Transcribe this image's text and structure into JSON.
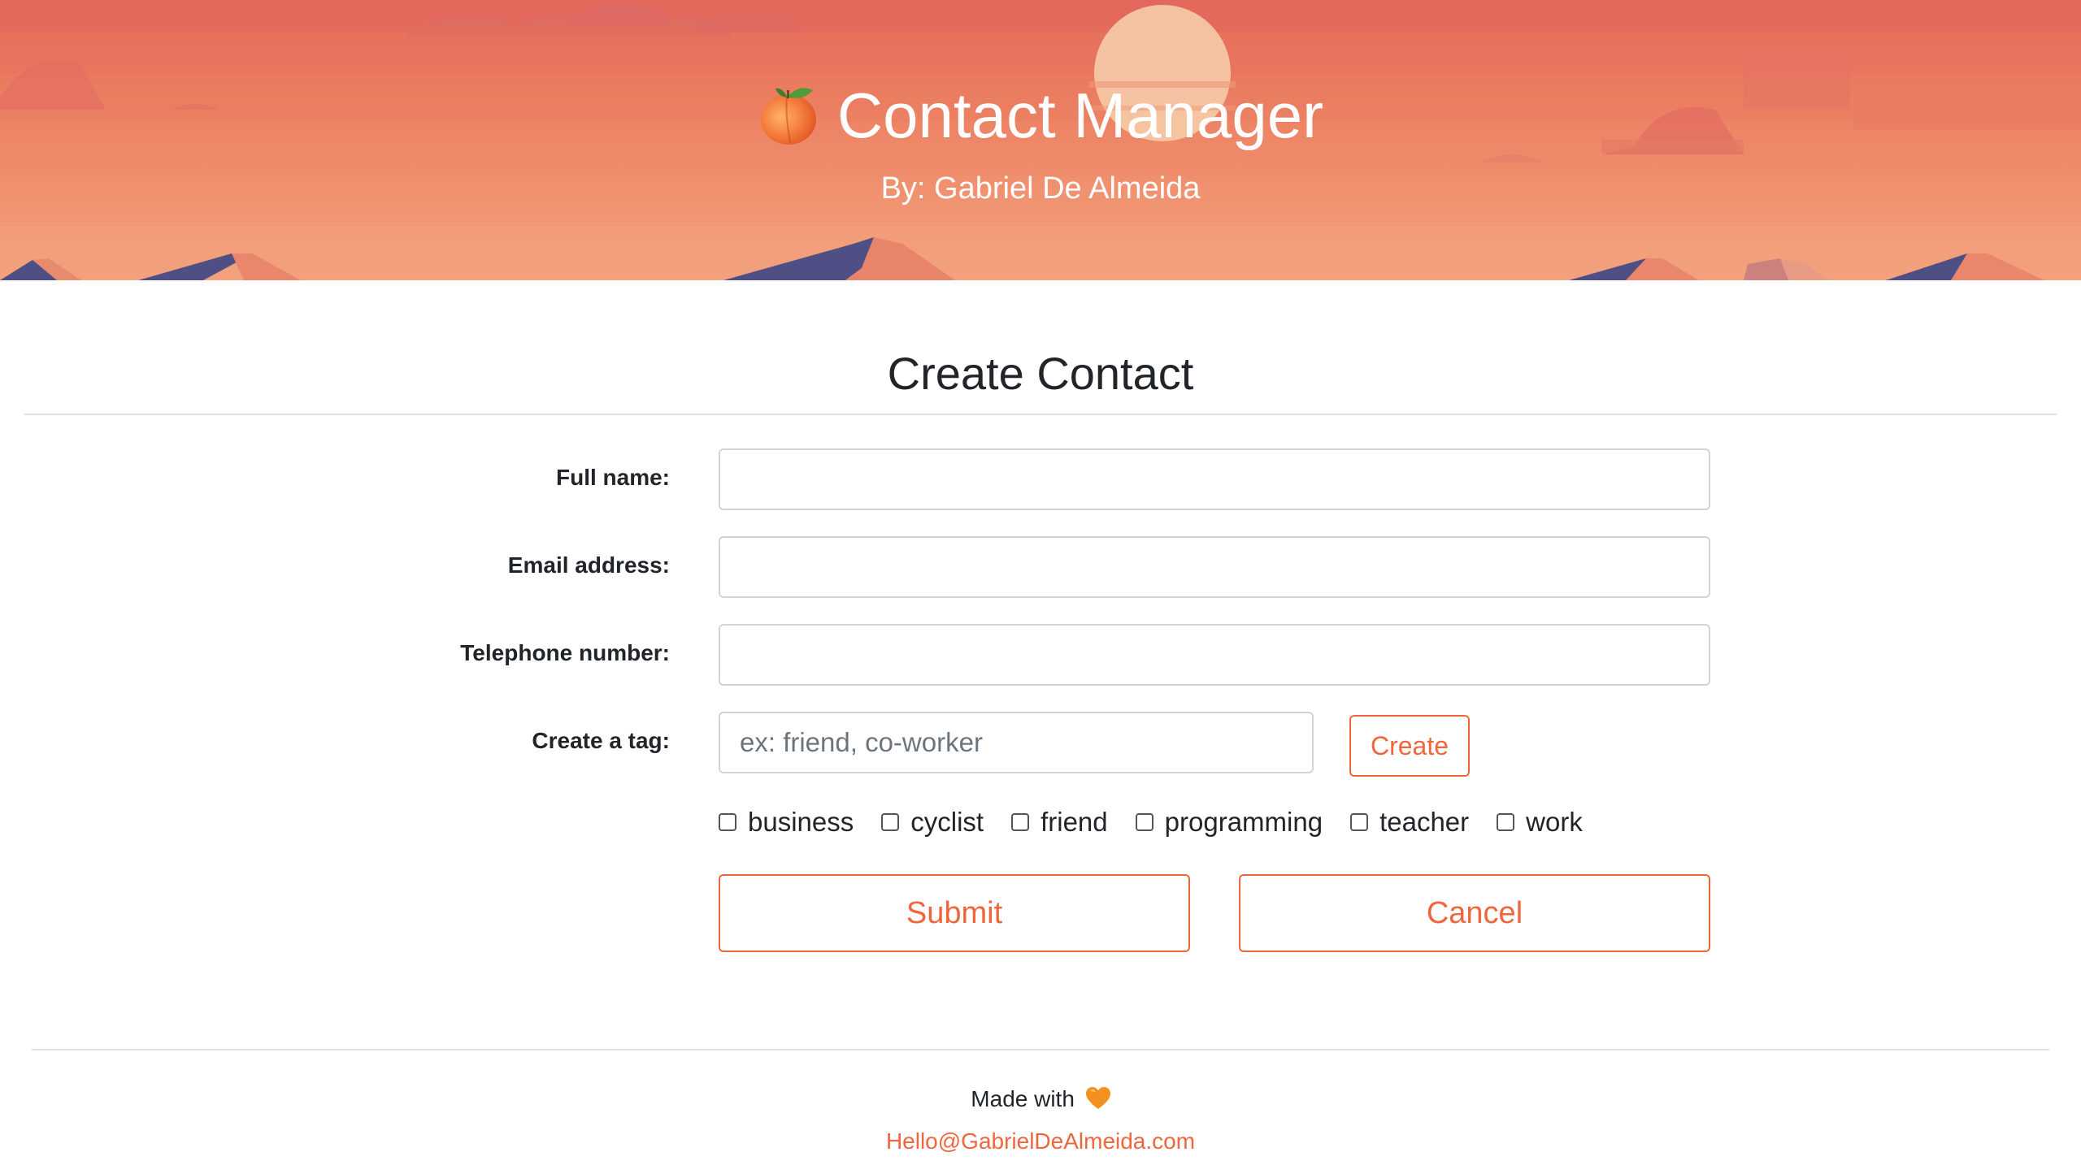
{
  "header": {
    "title": "Contact Manager",
    "byline": "By: Gabriel De Almeida",
    "logo_icon": "peach-icon",
    "colors": {
      "sky_top": "#e06a5c",
      "sky_bottom": "#f3a27e",
      "sun": "#f6c7a4",
      "mountain_shadow": "#4f4f86",
      "mountain_light": "#e88a6e"
    }
  },
  "form": {
    "title": "Create Contact",
    "full_name": {
      "label": "Full name:",
      "value": ""
    },
    "email": {
      "label": "Email address:",
      "value": ""
    },
    "telephone": {
      "label": "Telephone number:",
      "value": ""
    },
    "tag": {
      "label": "Create a tag:",
      "placeholder": "ex: friend, co-worker",
      "create_label": "Create"
    },
    "tags": [
      {
        "label": "business",
        "checked": false
      },
      {
        "label": "cyclist",
        "checked": false
      },
      {
        "label": "friend",
        "checked": false
      },
      {
        "label": "programming",
        "checked": false
      },
      {
        "label": "teacher",
        "checked": false
      },
      {
        "label": "work",
        "checked": false
      }
    ],
    "submit_label": "Submit",
    "cancel_label": "Cancel",
    "accent_color": "#f0663c"
  },
  "footer": {
    "made_with": "Made with",
    "heart_icon": "orange-heart-icon",
    "email_link": "Hello@GabrielDeAlmeida.com"
  }
}
